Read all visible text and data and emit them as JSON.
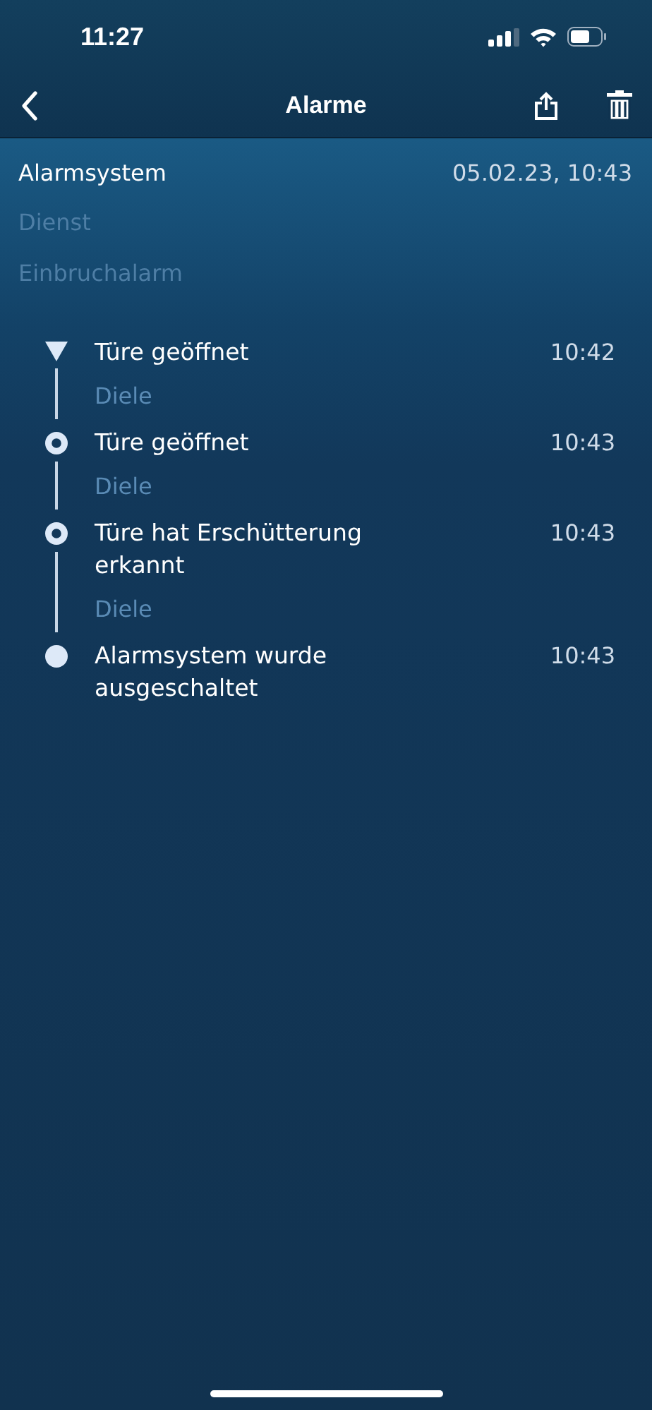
{
  "status_bar": {
    "time": "11:27"
  },
  "nav": {
    "title": "Alarme"
  },
  "alarm": {
    "system": "Alarmsystem",
    "datetime": "05.02.23, 10:43",
    "service": "Dienst",
    "type": "Einbruchalarm"
  },
  "events": [
    {
      "kind": "start",
      "title": "Türe geöffnet",
      "time": "10:42",
      "location": "Diele"
    },
    {
      "kind": "step",
      "title": "Türe geöffnet",
      "time": "10:43",
      "location": "Diele"
    },
    {
      "kind": "step",
      "title": "Türe hat Erschütterung erkannt",
      "time": "10:43",
      "location": "Diele"
    },
    {
      "kind": "end",
      "title": "Alarmsystem wurde ausgeschaltet",
      "time": "10:43"
    }
  ]
}
